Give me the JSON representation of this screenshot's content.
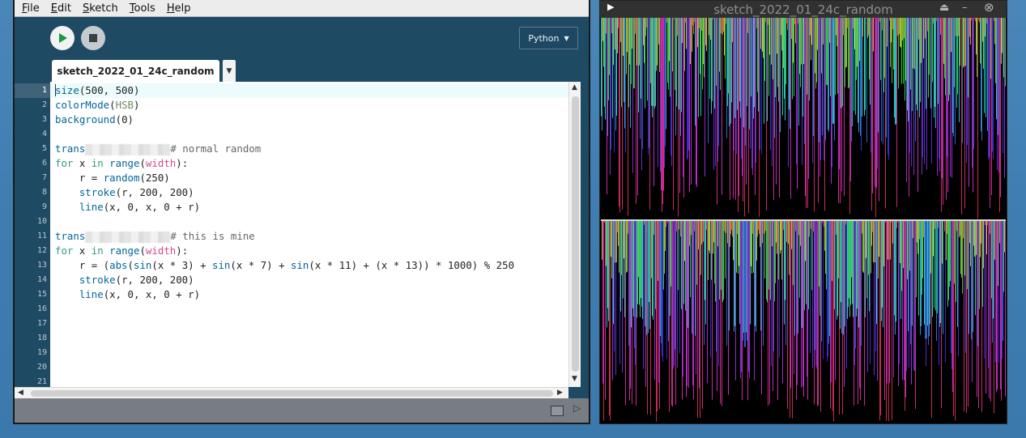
{
  "menu": {
    "items": [
      {
        "u": "F",
        "rest": "ile"
      },
      {
        "u": "E",
        "rest": "dit"
      },
      {
        "u": "S",
        "rest": "ketch"
      },
      {
        "u": "T",
        "rest": "ools"
      },
      {
        "u": "H",
        "rest": "elp"
      }
    ]
  },
  "toolbar": {
    "mode_label": "Python",
    "mode_arrow": "▼"
  },
  "tabs": [
    {
      "label": "sketch_2022_01_24c_random"
    }
  ],
  "tab_menu_arrow": "▼",
  "editor": {
    "line_numbers": [
      "1",
      "2",
      "3",
      "4",
      "5",
      "6",
      "7",
      "8",
      "9",
      "10",
      "11",
      "12",
      "13",
      "14",
      "15",
      "16",
      "17",
      "18",
      "19",
      "20",
      "21"
    ],
    "current_line": 1
  },
  "code": {
    "l1_fn": "size",
    "l1_rest": "(500, 500)",
    "l2_fn": "colorMode",
    "l2_p1": "(",
    "l2_const": "HSB",
    "l2_p2": ")",
    "l3_fn": "background",
    "l3_rest": "(0)",
    "l5_pre": "trans",
    "l5_comment": "# normal random",
    "l6_for": "for",
    "l6_x": " x ",
    "l6_in": "in",
    "l6_sp": " ",
    "l6_range": "range",
    "l6_p1": "(",
    "l6_width": "width",
    "l6_p2": "):",
    "l7_pre": "    r = ",
    "l7_fn": "random",
    "l7_rest": "(250)",
    "l8_pre": "    ",
    "l8_fn": "stroke",
    "l8_rest": "(r, 200, 200)",
    "l9_pre": "    ",
    "l9_fn": "line",
    "l9_rest": "(x, 0, x, 0 + r)",
    "l11_pre": "trans",
    "l11_comment": "# this is mine",
    "l12_for": "for",
    "l12_x": " x ",
    "l12_in": "in",
    "l12_sp": " ",
    "l12_range": "range",
    "l12_p1": "(",
    "l12_width": "width",
    "l12_p2": "):",
    "l13_a": "    r = (",
    "l13_abs": "abs",
    "l13_b": "(",
    "l13_sin1": "sin",
    "l13_c": "(x * 3) + ",
    "l13_sin2": "sin",
    "l13_d": "(x * 7) + ",
    "l13_sin3": "sin",
    "l13_e": "(x * 11) + (x * 13)) * 1000) % 250",
    "l14_pre": "    ",
    "l14_fn": "stroke",
    "l14_rest": "(r, 200, 200)",
    "l15_pre": "    ",
    "l15_fn": "line",
    "l15_rest": "(x, 0, x, 0 + r)"
  },
  "sketch_window": {
    "title": "sketch_2022_01_24c_random"
  },
  "colors": {
    "ide_bg": "#1f4a64",
    "keyword": "#33997e",
    "function": "#006699",
    "constant": "#718a62",
    "builtin_var": "#d9488b",
    "comment": "#666666"
  }
}
